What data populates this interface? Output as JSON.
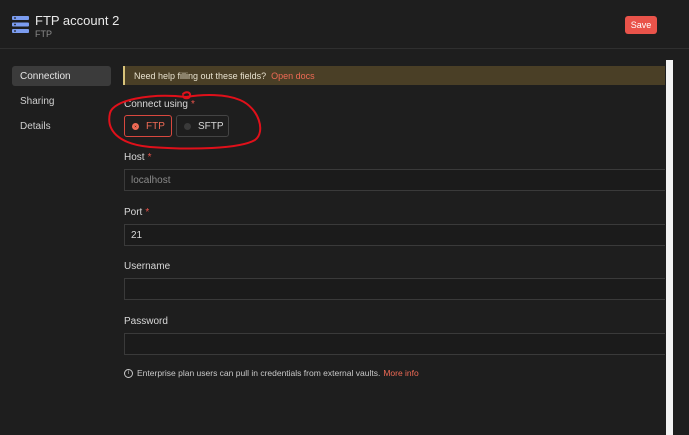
{
  "header": {
    "title": "FTP account 2",
    "subtitle": "FTP",
    "app_icon": "server-stack-icon",
    "save_label": "Save"
  },
  "sidebar": {
    "items": [
      {
        "label": "Connection",
        "active": true
      },
      {
        "label": "Sharing",
        "active": false
      },
      {
        "label": "Details",
        "active": false
      }
    ]
  },
  "banner": {
    "text": "Need help filling out these fields?",
    "link": "Open docs"
  },
  "form": {
    "connect_label": "Connect using",
    "required_mark": "*",
    "options": [
      {
        "label": "FTP",
        "selected": true
      },
      {
        "label": "SFTP",
        "selected": false
      }
    ],
    "host_label": "Host",
    "host_placeholder": "localhost",
    "port_label": "Port",
    "port_value": "21",
    "username_label": "Username",
    "username_value": "",
    "password_label": "Password",
    "password_value": ""
  },
  "footer": {
    "icon": "info-icon",
    "text": "Enterprise plan users can pull in credentials from external vaults.",
    "link": "More info"
  },
  "colors": {
    "accent": "#e9534a",
    "banner_bg": "#4a3f26",
    "annotation": "#e0101a"
  }
}
